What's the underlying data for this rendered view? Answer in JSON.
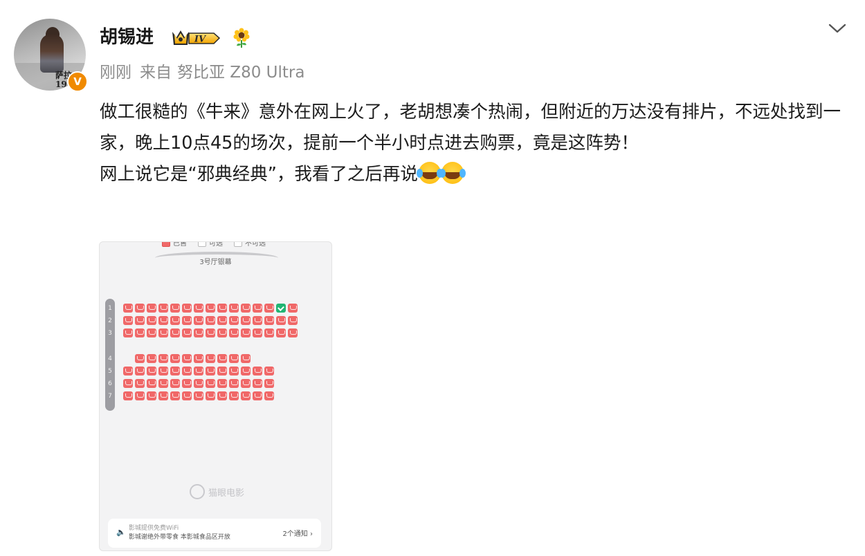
{
  "author": {
    "name": "胡锡进",
    "level": "IV",
    "verified_mark": "V",
    "avatar_text": [
      "萨拉",
      "19"
    ]
  },
  "post_meta": {
    "time": "刚刚",
    "source_prefix": "来自",
    "device": "努比亚 Z80 Ultra"
  },
  "post": {
    "paragraph1": "做工很糙的《牛来》意外在网上火了，老胡想凑个热闹，但附近的万达没有排片，不远处找到一家，晚上10点45的场次，提前一个半小时点进去购票，竟是这阵势！",
    "paragraph2": "网上说它是“邪典经典”，我看了之后再说"
  },
  "image": {
    "legend": [
      "已售",
      "可选",
      "不可选"
    ],
    "screen_label": "3号厅银幕",
    "row_labels": [
      "1",
      "2",
      "3",
      "4",
      "5",
      "6",
      "7"
    ],
    "watermark": "猫眼电影",
    "notice_line1": "影城提供免费WiFi",
    "notice_line2": "影城谢绝外带零食    本影城食品区开放",
    "notice_count": "2个通知"
  },
  "icons": {
    "header_toggle": "chevron-down-icon",
    "level": "crown-level-badge-icon",
    "flower": "sunflower-icon",
    "emoji": "laughing-tears-emoji-icon",
    "notice": "speaker-icon"
  },
  "colors": {
    "verified": "#f08a00",
    "sold_seat": "#f06868",
    "selected_seat": "#22b573",
    "meta_text": "#8c8c8c"
  }
}
